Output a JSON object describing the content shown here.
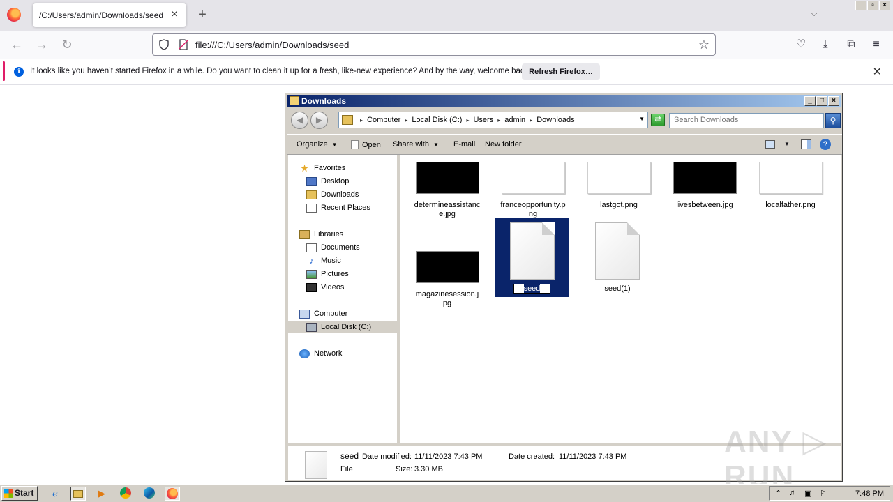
{
  "browser": {
    "tab_title": "/C:/Users/admin/Downloads/seed",
    "url": "file:///C:/Users/admin/Downloads/seed",
    "notification": {
      "text": "It looks like you haven’t started Firefox in a while. Do you want to clean it up for a fresh, like-new experience? And by the way, welcome back!",
      "button_label": "Refresh Firefox…"
    }
  },
  "explorer": {
    "title": "Downloads",
    "breadcrumb": [
      "Computer",
      "Local Disk (C:)",
      "Users",
      "admin",
      "Downloads"
    ],
    "search_placeholder": "Search Downloads",
    "toolbar": {
      "organize": "Organize",
      "open": "Open",
      "share_with": "Share with",
      "email": "E-mail",
      "new_folder": "New folder"
    },
    "nav": {
      "favorites": "Favorites",
      "desktop": "Desktop",
      "downloads": "Downloads",
      "recent_places": "Recent Places",
      "libraries": "Libraries",
      "documents": "Documents",
      "music": "Music",
      "pictures": "Pictures",
      "videos": "Videos",
      "computer": "Computer",
      "local_disk": "Local Disk (C:)",
      "network": "Network"
    },
    "files": [
      {
        "name": "determineassistance.jpg",
        "thumb": "black"
      },
      {
        "name": "franceopportunity.png",
        "thumb": "white"
      },
      {
        "name": "lastgot.png",
        "thumb": "white"
      },
      {
        "name": "livesbetween.jpg",
        "thumb": "black"
      },
      {
        "name": "localfather.png",
        "thumb": "white"
      },
      {
        "name": "magazinesession.jpg",
        "thumb": "black"
      },
      {
        "name": "seed",
        "thumb": "doc",
        "selected": true
      },
      {
        "name": "seed(1)",
        "thumb": "doc"
      }
    ],
    "details": {
      "name": "seed",
      "type": "File",
      "date_modified_label": "Date modified:",
      "date_modified": "11/11/2023 7:43 PM",
      "date_created_label": "Date created:",
      "date_created": "11/11/2023 7:43 PM",
      "size_label": "Size:",
      "size": "3.30 MB"
    }
  },
  "taskbar": {
    "start_label": "Start",
    "clock": "7:48 PM"
  },
  "watermark": "ANY ▷ RUN",
  "colors": {
    "selection": "#0a246a",
    "notification_accent": "#e01d68",
    "firefox_button_bg": "#e9e9ed"
  }
}
